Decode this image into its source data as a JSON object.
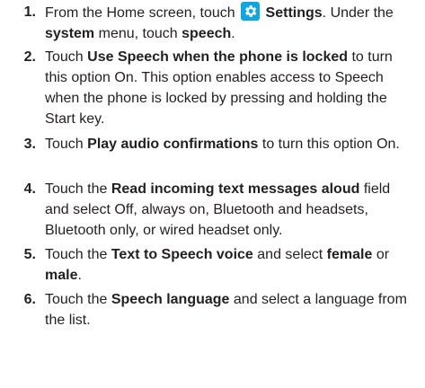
{
  "steps": [
    {
      "number": "1.",
      "pre": "From the Home screen, touch",
      "settings_label": "Settings",
      "mid": ". Under the",
      "system": "system",
      "mid2": "menu, touch",
      "speech": "speech",
      "end": "."
    },
    {
      "number": "2.",
      "pre": "Touch",
      "bold": "Use Speech when the phone is locked",
      "post": "to turn this option On. This option enables access to Speech when the phone is locked by pressing and holding the Start key."
    },
    {
      "number": "3.",
      "pre": "Touch",
      "bold": "Play audio confirmations",
      "post": "to turn this option On."
    },
    {
      "number": "4.",
      "pre": "Touch the",
      "bold": "Read incoming text messages aloud",
      "post": "field and select Off, always on, Bluetooth and headsets, Bluetooth only, or wired headset only."
    },
    {
      "number": "5.",
      "pre": "Touch the",
      "bold": "Text to Speech voice",
      "mid": "and select",
      "bold2": "female",
      "mid2": "or",
      "bold3": "male",
      "end": "."
    },
    {
      "number": "6.",
      "pre": "Touch the",
      "bold": "Speech language",
      "post": "and select a language from the list."
    }
  ],
  "icons": {
    "settings": "gear-icon"
  },
  "colors": {
    "text": "#231f20",
    "settings_icon_bg": "#10a7e0"
  }
}
